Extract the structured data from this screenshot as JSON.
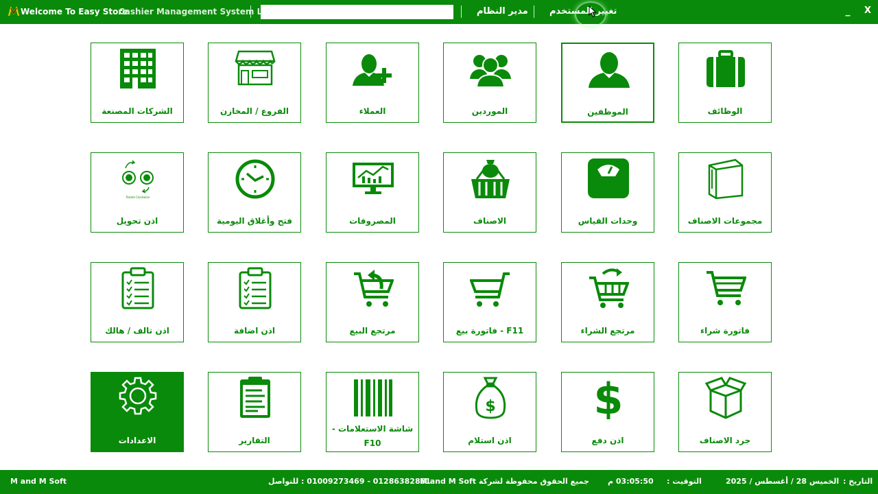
{
  "header": {
    "welcome": "Welcome To Easy Store",
    "system_name": "Cashier Management System L4",
    "search_value": "",
    "admin": "مدير النظام",
    "change_user": "تغيير المستخدم",
    "minimize": "_",
    "close": "X"
  },
  "tiles": [
    {
      "label": "الوظائف",
      "icon": "briefcase-icon"
    },
    {
      "label": "الموظفين",
      "icon": "employee-icon"
    },
    {
      "label": "الموردين",
      "icon": "suppliers-icon"
    },
    {
      "label": "العملاء",
      "icon": "add-customer-icon"
    },
    {
      "label": "الفروع / المخازن",
      "icon": "store-icon"
    },
    {
      "label": "الشركات المصنعة",
      "icon": "building-icon"
    },
    {
      "label": "مجموعات الاصناف",
      "icon": "shopping-bag-icon"
    },
    {
      "label": "وحدات القياس",
      "icon": "scale-icon"
    },
    {
      "label": "الاصناف",
      "icon": "basket-icon"
    },
    {
      "label": "المصروفات",
      "icon": "monitor-chart-icon"
    },
    {
      "label": "فتح وأغلاق اليومية",
      "icon": "clock-icon"
    },
    {
      "label": "اذن تحويل",
      "icon": "rotate-clockwise-icon",
      "caption": "Rotate Clockwise"
    },
    {
      "label": "فاتورة شراء",
      "icon": "cart-icon"
    },
    {
      "label": "مرتجع الشراء",
      "icon": "cart-return-icon"
    },
    {
      "label": "F11 - فاتورة بيع",
      "icon": "cart-sale-icon"
    },
    {
      "label": "مرتجع البيع",
      "icon": "cart-back-icon"
    },
    {
      "label": "اذن اضافة",
      "icon": "clipboard-icon"
    },
    {
      "label": "اذن تالف / هالك",
      "icon": "clipboard-damage-icon"
    },
    {
      "label": "جرد الاصناف",
      "icon": "box-icon"
    },
    {
      "label": "اذن دفع",
      "icon": "dollar-icon"
    },
    {
      "label": "اذن استلام",
      "icon": "money-bag-icon"
    },
    {
      "label": "شاشة الاستعلامات -",
      "label2": "F10",
      "icon": "barcode-icon"
    },
    {
      "label": "التقارير",
      "icon": "report-icon"
    },
    {
      "label": "الاعدادات",
      "icon": "gear-icon"
    }
  ],
  "footer": {
    "company": "M and M Soft",
    "phones": "01286382861 - 01009273469 : للتواصل",
    "rights": "جميع الحقوق محفوظة لشركة M and M Soft",
    "time": "03:05:50 م",
    "time_label": "التوقيت :",
    "date": "الخميس 28 / أغسطس / 2025",
    "date_label": "التاريخ :"
  },
  "colors": {
    "brand": "#0a8a0a",
    "background": "#ffffff"
  }
}
